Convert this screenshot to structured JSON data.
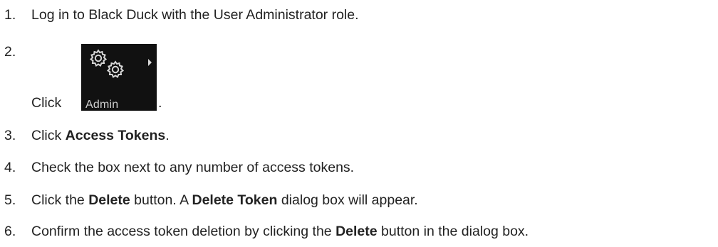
{
  "steps": [
    {
      "number": "1.",
      "parts": [
        {
          "text": "Log in to Black Duck with the User Administrator role.",
          "bold": false
        }
      ]
    },
    {
      "number": "2.",
      "pre": "Click",
      "post": ".",
      "image": {
        "label": "Admin",
        "icon": "gears-icon"
      }
    },
    {
      "number": "3.",
      "parts": [
        {
          "text": "Click ",
          "bold": false
        },
        {
          "text": "Access Tokens",
          "bold": true
        },
        {
          "text": ".",
          "bold": false
        }
      ]
    },
    {
      "number": "4.",
      "parts": [
        {
          "text": "Check the box next to any number of access tokens.",
          "bold": false
        }
      ]
    },
    {
      "number": "5.",
      "parts": [
        {
          "text": "Click the ",
          "bold": false
        },
        {
          "text": "Delete",
          "bold": true
        },
        {
          "text": " button. A ",
          "bold": false
        },
        {
          "text": "Delete Token",
          "bold": true
        },
        {
          "text": " dialog box will appear.",
          "bold": false
        }
      ]
    },
    {
      "number": "6.",
      "parts": [
        {
          "text": "Confirm the access token deletion by clicking the ",
          "bold": false
        },
        {
          "text": "Delete",
          "bold": true
        },
        {
          "text": " button in the dialog box.",
          "bold": false
        }
      ]
    }
  ]
}
